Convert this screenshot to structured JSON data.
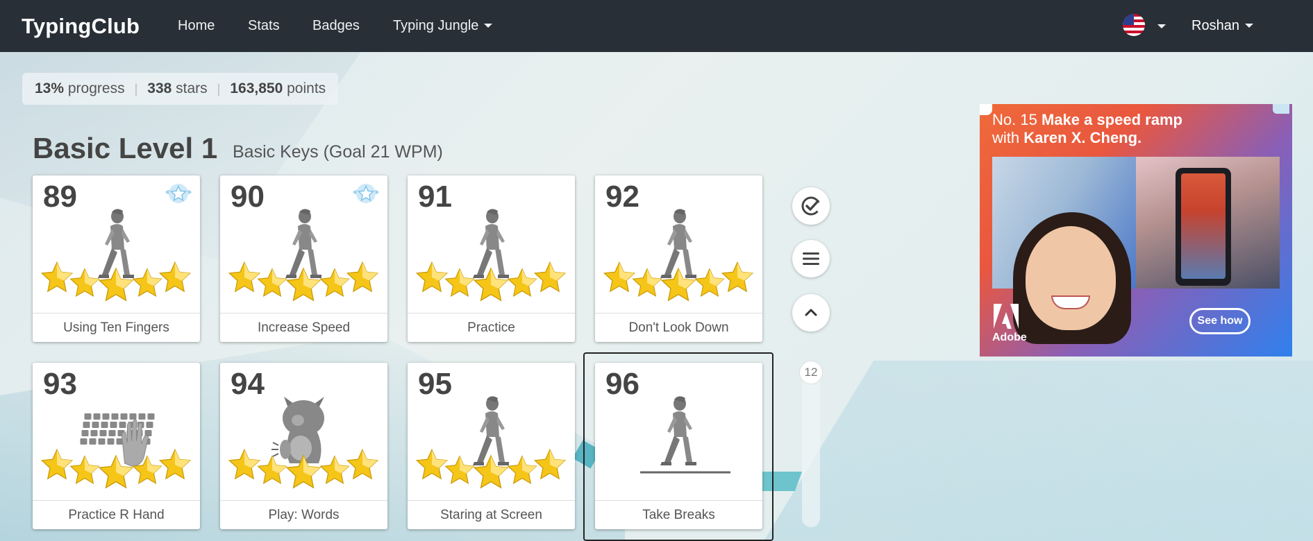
{
  "navbar": {
    "brand": "TypingClub",
    "items": [
      {
        "label": "Home"
      },
      {
        "label": "Stats"
      },
      {
        "label": "Badges"
      },
      {
        "label": "Typing Jungle"
      }
    ],
    "user": "Roshan"
  },
  "progress": {
    "percent": "13%",
    "percent_label": "progress",
    "stars": "338",
    "stars_label": "stars",
    "points": "163,850",
    "points_label": "points"
  },
  "level": {
    "title": "Basic Level 1",
    "subtitle": "Basic Keys (Goal 21 WPM)"
  },
  "lessons": [
    {
      "number": "89",
      "label": "Using Ten Fingers",
      "icon": "walking-person-icon",
      "stars": 5,
      "badge": true
    },
    {
      "number": "90",
      "label": "Increase Speed",
      "icon": "walking-person-icon",
      "stars": 5,
      "badge": true
    },
    {
      "number": "91",
      "label": "Practice",
      "icon": "walking-person-icon",
      "stars": 5,
      "badge": false
    },
    {
      "number": "92",
      "label": "Don't Look Down",
      "icon": "walking-person-icon",
      "stars": 5,
      "badge": false
    },
    {
      "number": "93",
      "label": "Practice R Hand",
      "icon": "keyboard-hand-icon",
      "stars": 5,
      "badge": false
    },
    {
      "number": "94",
      "label": "Play: Words",
      "icon": "monster-icon",
      "stars": 5,
      "badge": false
    },
    {
      "number": "95",
      "label": "Staring at Screen",
      "icon": "walking-person-icon",
      "stars": 5,
      "badge": false
    },
    {
      "number": "96",
      "label": "Take Breaks",
      "icon": "walking-person-icon",
      "stars": 0,
      "badge": false,
      "selected": true
    }
  ],
  "side_controls": {
    "page_number": "12"
  },
  "ad": {
    "headline_prefix": "No. 15",
    "headline_bold": "Make a speed ramp",
    "headline_line2_prefix": "with",
    "headline_line2_bold": "Karen X. Cheng.",
    "brand": "Adobe",
    "cta": "See how"
  },
  "colors": {
    "navbar": "#282f36",
    "star": "#f5c518",
    "text_dark": "#444444"
  }
}
